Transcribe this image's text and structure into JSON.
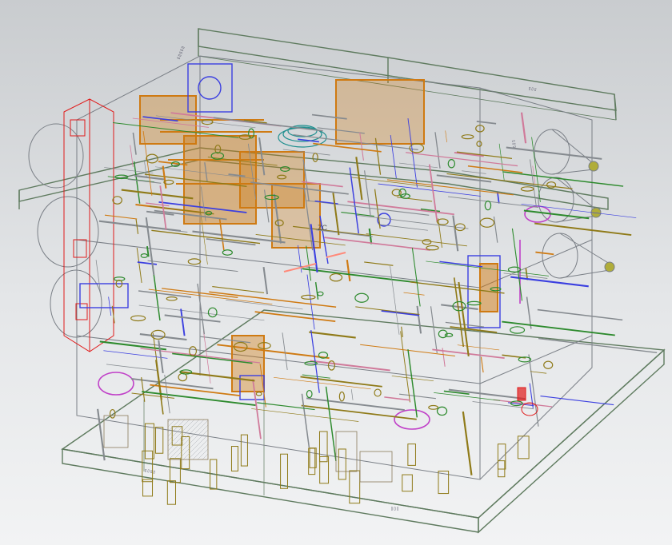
{
  "viewport": {
    "background_top": "#c9cccf",
    "background_bottom": "#f2f3f4",
    "render_mode": "wireframe-transparent",
    "center_axis_label": "ZC"
  },
  "model": {
    "frame_color": "#5e7a5e",
    "edge_color": "#7a7f86",
    "colors": {
      "orange": "#cf7a12",
      "olive": "#8f7a18",
      "gray": "#858a8f",
      "blue": "#3b3fe0",
      "green": "#2d8a2d",
      "teal": "#1f8f8f",
      "red": "#e01a1a",
      "magenta": "#c040c8",
      "pink": "#d07a9a"
    }
  }
}
